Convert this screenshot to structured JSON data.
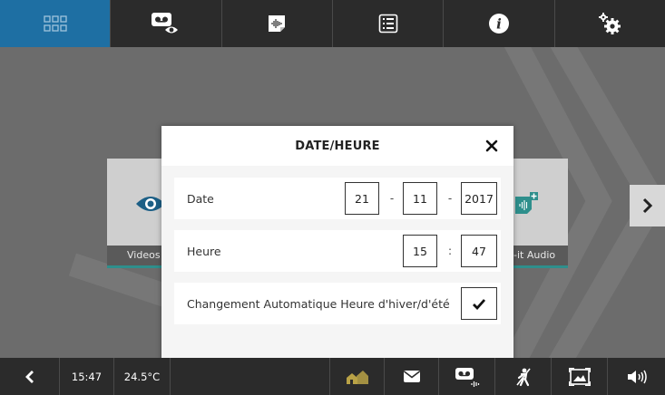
{
  "topbar": {
    "buttons": [
      {
        "icon": "grid-icon",
        "active": true
      },
      {
        "icon": "videomessage-icon"
      },
      {
        "icon": "audio-memo-icon"
      },
      {
        "icon": "list-icon"
      },
      {
        "icon": "info-icon"
      },
      {
        "icon": "settings-gears-icon"
      }
    ]
  },
  "tiles": {
    "left_caption": "Videos",
    "right_caption": "-it Audio"
  },
  "dialog": {
    "title": "DATE/HEURE",
    "date": {
      "label": "Date",
      "day": "21",
      "month": "11",
      "year": "2017",
      "separator": "-"
    },
    "time": {
      "label": "Heure",
      "hour": "15",
      "minute": "47",
      "separator": ":"
    },
    "dst": {
      "label": "Changement Automatique Heure d'hiver/d'été",
      "checked": true
    }
  },
  "statusbar": {
    "time": "15:47",
    "temperature": "24.5°C",
    "icons": [
      "back-arrow-icon",
      "home-away-icon",
      "mail-icon",
      "videomessage-icon",
      "do-not-disturb-icon",
      "image-frame-icon",
      "volume-icon"
    ]
  },
  "colors": {
    "active_tab": "#1e6fa3",
    "bar_background": "#2b2b2b",
    "accent_teal": "#2e8f8c",
    "home_icon_yellow": "#b9a246"
  }
}
